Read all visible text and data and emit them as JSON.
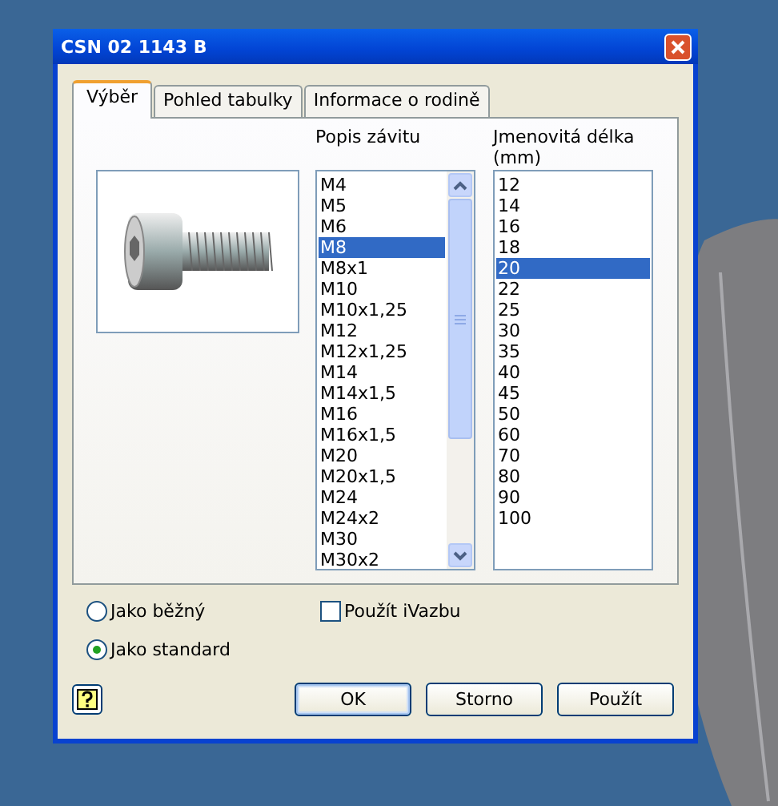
{
  "window": {
    "title": "CSN 02 1143 B"
  },
  "tabs": [
    {
      "label": "Výběr",
      "selected": true
    },
    {
      "label": "Pohled tabulky",
      "selected": false
    },
    {
      "label": "Informace o rodině",
      "selected": false
    }
  ],
  "thread_list": {
    "heading": "Popis závitu",
    "items": [
      {
        "label": "M4",
        "selected": false
      },
      {
        "label": "M5",
        "selected": false
      },
      {
        "label": "M6",
        "selected": false
      },
      {
        "label": "M8",
        "selected": true
      },
      {
        "label": "M8x1",
        "selected": false
      },
      {
        "label": "M10",
        "selected": false
      },
      {
        "label": "M10x1,25",
        "selected": false
      },
      {
        "label": "M12",
        "selected": false
      },
      {
        "label": "M12x1,25",
        "selected": false
      },
      {
        "label": "M14",
        "selected": false
      },
      {
        "label": "M14x1,5",
        "selected": false
      },
      {
        "label": "M16",
        "selected": false
      },
      {
        "label": "M16x1,5",
        "selected": false
      },
      {
        "label": "M20",
        "selected": false
      },
      {
        "label": "M20x1,5",
        "selected": false
      },
      {
        "label": "M24",
        "selected": false
      },
      {
        "label": "M24x2",
        "selected": false
      },
      {
        "label": "M30",
        "selected": false
      },
      {
        "label": "M30x2",
        "selected": false
      }
    ]
  },
  "length_list": {
    "heading": "Jmenovitá délka (mm)",
    "items": [
      {
        "label": "12",
        "selected": false
      },
      {
        "label": "14",
        "selected": false
      },
      {
        "label": "16",
        "selected": false
      },
      {
        "label": "18",
        "selected": false
      },
      {
        "label": "20",
        "selected": true
      },
      {
        "label": "22",
        "selected": false
      },
      {
        "label": "25",
        "selected": false
      },
      {
        "label": "30",
        "selected": false
      },
      {
        "label": "35",
        "selected": false
      },
      {
        "label": "40",
        "selected": false
      },
      {
        "label": "45",
        "selected": false
      },
      {
        "label": "50",
        "selected": false
      },
      {
        "label": "60",
        "selected": false
      },
      {
        "label": "70",
        "selected": false
      },
      {
        "label": "80",
        "selected": false
      },
      {
        "label": "90",
        "selected": false
      },
      {
        "label": "100",
        "selected": false
      }
    ]
  },
  "options": [
    {
      "label": "Jako běžný",
      "selected": false
    },
    {
      "label": "Jako standard",
      "selected": true
    }
  ],
  "checkbox": {
    "label": "Použít iVazbu",
    "checked": false
  },
  "buttons": [
    {
      "label": "OK",
      "default": true
    },
    {
      "label": "Storno",
      "default": false
    },
    {
      "label": "Použít",
      "default": false
    }
  ]
}
